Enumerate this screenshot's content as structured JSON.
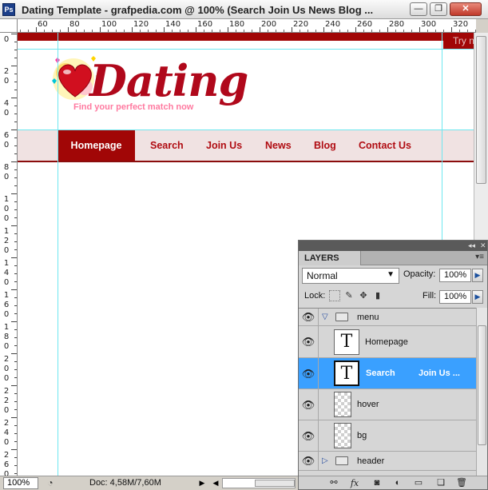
{
  "window": {
    "title": "Dating Template - grafpedia.com @ 100% (Search      Join Us       News       Blog ...",
    "app_icon": "Ps",
    "buttons": {
      "minimize": "—",
      "restore": "❐",
      "close": "✕"
    }
  },
  "rulers": {
    "horizontal": [
      "60",
      "80",
      "100",
      "120",
      "140",
      "160",
      "180",
      "200",
      "220",
      "240",
      "260",
      "280",
      "300",
      "320"
    ],
    "vertical": [
      {
        "digits": [
          "0"
        ]
      },
      {
        "digits": [
          "2",
          "0"
        ]
      },
      {
        "digits": [
          "4",
          "0"
        ]
      },
      {
        "digits": [
          "6",
          "0"
        ]
      },
      {
        "digits": [
          "8",
          "0"
        ]
      },
      {
        "digits": [
          "1",
          "0",
          "0"
        ]
      },
      {
        "digits": [
          "1",
          "2",
          "0"
        ]
      },
      {
        "digits": [
          "1",
          "4",
          "0"
        ]
      },
      {
        "digits": [
          "1",
          "6",
          "0"
        ]
      },
      {
        "digits": [
          "1",
          "8",
          "0"
        ]
      },
      {
        "digits": [
          "2",
          "0",
          "0"
        ]
      },
      {
        "digits": [
          "2",
          "2",
          "0"
        ]
      },
      {
        "digits": [
          "2",
          "4",
          "0"
        ]
      },
      {
        "digits": [
          "2",
          "6",
          "0"
        ]
      }
    ]
  },
  "document": {
    "try_button": "Try n",
    "logo_text": "Dating",
    "tagline": "Find your perfect match now",
    "menu": [
      "Homepage",
      "Search",
      "Join Us",
      "News",
      "Blog",
      "Contact Us"
    ],
    "active_menu": "Homepage",
    "colors": {
      "brand_red": "#a10606",
      "menu_bg": "#f0e2e2",
      "guides": "#6fe7f0",
      "tagline": "#ff7aa0"
    }
  },
  "statusbar": {
    "zoom": "100%",
    "doc_info": "Doc: 4,58M/7,60M"
  },
  "layers_panel": {
    "tab": "LAYERS",
    "blend_mode": "Normal",
    "opacity_label": "Opacity:",
    "opacity_value": "100%",
    "lock_label": "Lock:",
    "fill_label": "Fill:",
    "fill_value": "100%",
    "layers": [
      {
        "name": "menu",
        "type": "group",
        "expanded": true
      },
      {
        "name": "Homepage",
        "type": "text"
      },
      {
        "name": "Search",
        "extra": "Join Us ...",
        "type": "text",
        "selected": true
      },
      {
        "name": "hover",
        "type": "raster"
      },
      {
        "name": "bg",
        "type": "raster"
      },
      {
        "name": "header",
        "type": "group",
        "expanded": false
      }
    ],
    "selection_color": "#3aa0ff"
  }
}
